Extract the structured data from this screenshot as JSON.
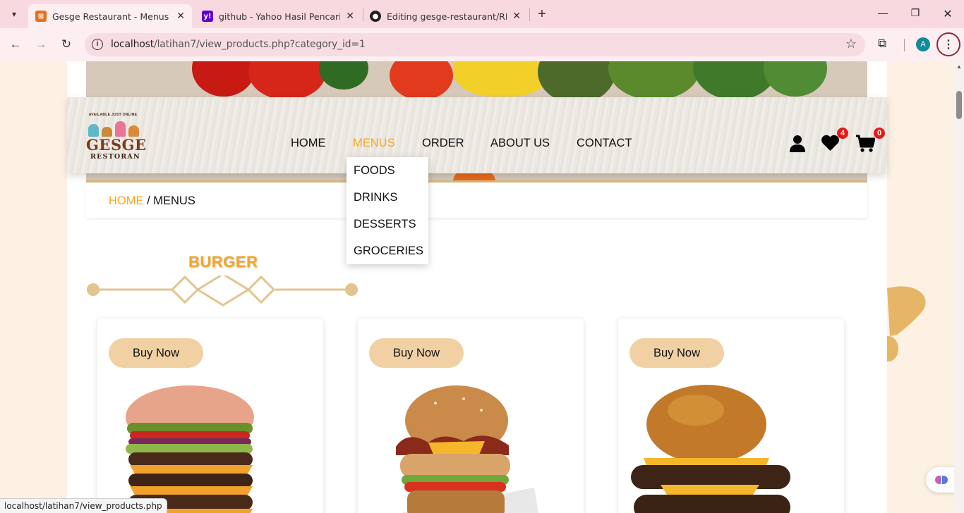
{
  "browser": {
    "tabs": [
      {
        "title": "Gesge Restaurant - Menus",
        "active": true
      },
      {
        "title": "github - Yahoo Hasil Pencarian",
        "active": false
      },
      {
        "title": "Editing gesge-restaurant/READI",
        "active": false
      }
    ],
    "url": {
      "host": "localhost",
      "path": "/latihan7/view_products.php?category_id=1"
    },
    "profile_initial": "A",
    "status_url": "localhost/latihan7/view_products.php"
  },
  "logo": {
    "tagline": "AVAILABLE JUST ONLINE",
    "name": "GESGE",
    "sub": "RESTORAN"
  },
  "nav": {
    "items": [
      "HOME",
      "MENUS",
      "ORDER",
      "ABOUT US",
      "CONTACT"
    ],
    "active": "MENUS",
    "wishlist_count": "4",
    "cart_count": "0"
  },
  "dropdown": {
    "items": [
      "FOODS",
      "DRINKS",
      "DESSERTS",
      "GROCERIES"
    ]
  },
  "breadcrumb": {
    "home": "HOME",
    "separator": " / ",
    "current": "MENUS"
  },
  "section": {
    "title": "BURGER"
  },
  "products": [
    {
      "button": "Buy Now"
    },
    {
      "button": "Buy Now"
    },
    {
      "button": "Buy Now"
    }
  ],
  "colors": {
    "accent": "#f5a623",
    "button": "#f1d1a4",
    "badge": "#e81818",
    "page_bg": "#fdf1e4",
    "tabstrip": "#f9d9e0"
  }
}
